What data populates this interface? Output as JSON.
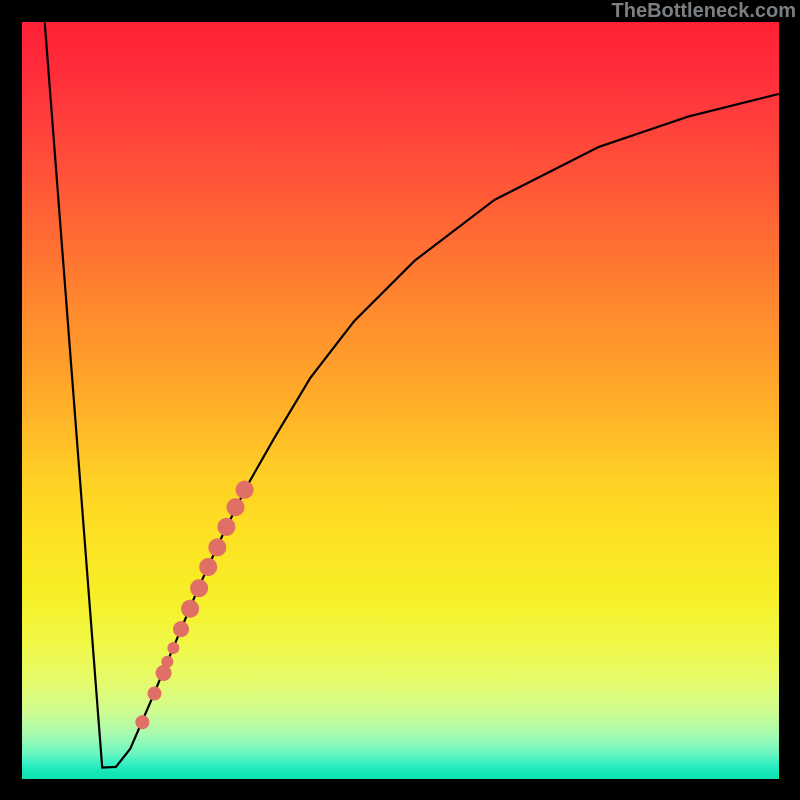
{
  "watermark": "TheBottleneck.com",
  "chart_data": {
    "type": "line",
    "title": "",
    "xlabel": "",
    "ylabel": "",
    "xlim": [
      0,
      100
    ],
    "ylim": [
      0,
      100
    ],
    "series": [
      {
        "name": "bottleneck-curve",
        "x": [
          3,
          10.6,
          12.4,
          14.3,
          16.9,
          19.0,
          21.1,
          23.2,
          26.4,
          29.6,
          33.3,
          38.1,
          43.9,
          51.9,
          62.4,
          76.2,
          88.0,
          100.0
        ],
        "y": [
          100,
          1.5,
          1.6,
          4.0,
          10.0,
          15.0,
          20.0,
          25.0,
          32.0,
          38.5,
          45.0,
          53.0,
          60.5,
          68.5,
          76.5,
          83.5,
          87.5,
          90.5
        ]
      }
    ],
    "markers": [
      {
        "x": 15.9,
        "y": 7.5,
        "r": 7
      },
      {
        "x": 17.5,
        "y": 11.3,
        "r": 7
      },
      {
        "x": 18.7,
        "y": 14.0,
        "r": 8
      },
      {
        "x": 19.2,
        "y": 15.5,
        "r": 6
      },
      {
        "x": 20.0,
        "y": 17.3,
        "r": 6
      },
      {
        "x": 21.0,
        "y": 19.8,
        "r": 8
      },
      {
        "x": 22.2,
        "y": 22.5,
        "r": 9
      },
      {
        "x": 23.4,
        "y": 25.2,
        "r": 9
      },
      {
        "x": 24.6,
        "y": 28.0,
        "r": 9
      },
      {
        "x": 25.8,
        "y": 30.6,
        "r": 9
      },
      {
        "x": 27.0,
        "y": 33.3,
        "r": 9
      },
      {
        "x": 28.2,
        "y": 35.9,
        "r": 9
      },
      {
        "x": 29.4,
        "y": 38.2,
        "r": 9
      }
    ],
    "marker_color": "#e07066",
    "curve_color": "#000000"
  }
}
